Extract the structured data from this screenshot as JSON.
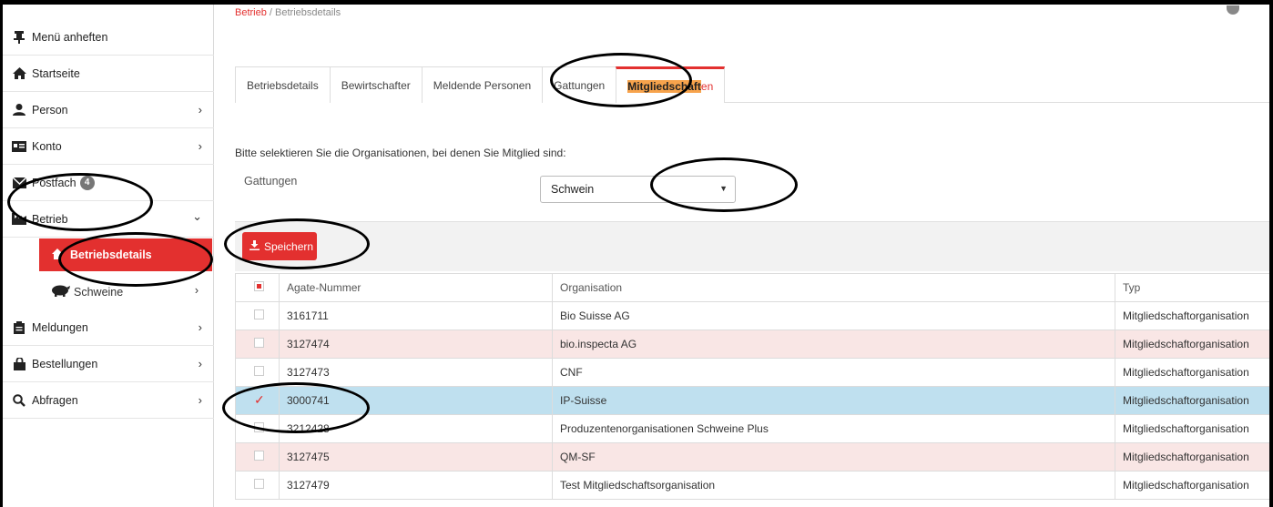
{
  "breadcrumb": {
    "first": "Betrieb",
    "sep": " / ",
    "second": "Betriebsdetails"
  },
  "sidebar": {
    "pin": {
      "label": "Menü anheften",
      "icon": "pin-icon"
    },
    "items": [
      {
        "label": "Startseite",
        "icon": "home-icon",
        "chevron": ""
      },
      {
        "label": "Person",
        "icon": "user-icon",
        "chevron": "›"
      },
      {
        "label": "Konto",
        "icon": "id-card-icon",
        "chevron": "›"
      },
      {
        "label": "Postfach",
        "icon": "envelope-icon",
        "chevron": "",
        "badge": "4"
      },
      {
        "label": "Betrieb",
        "icon": "factory-icon",
        "chevron": "⌄"
      },
      {
        "label": "Meldungen",
        "icon": "clipboard-icon",
        "chevron": "›"
      },
      {
        "label": "Bestellungen",
        "icon": "shopping-bag-icon",
        "chevron": "›"
      },
      {
        "label": "Abfragen",
        "icon": "search-icon",
        "chevron": "›"
      }
    ],
    "sub": [
      {
        "label": "Betriebsdetails",
        "icon": "home-icon",
        "active": true
      },
      {
        "label": "Schweine",
        "icon": "pig-icon",
        "chevron": "›"
      }
    ]
  },
  "tabs": [
    {
      "label": "Betriebsdetails"
    },
    {
      "label": "Bewirtschafter"
    },
    {
      "label": "Meldende Personen"
    },
    {
      "label": "Gattungen"
    },
    {
      "label_hl": "Mitgliedschaft",
      "label_rest": "en",
      "active": true
    }
  ],
  "hint": "Bitte selektieren Sie die Organisationen, bei denen Sie Mitglied sind:",
  "gattungen": {
    "label": "Gattungen",
    "selected": "Schwein"
  },
  "save_button": "Speichern",
  "table": {
    "headers": [
      "Agate-Nummer",
      "Organisation",
      "Typ"
    ],
    "rows": [
      {
        "agate": "3161711",
        "org": "Bio Suisse AG",
        "typ": "Mitgliedschaftorganisation",
        "checked": false
      },
      {
        "agate": "3127474",
        "org": "bio.inspecta AG",
        "typ": "Mitgliedschaftorganisation",
        "checked": false
      },
      {
        "agate": "3127473",
        "org": "CNF",
        "typ": "Mitgliedschaftorganisation",
        "checked": false
      },
      {
        "agate": "3000741",
        "org": "IP-Suisse",
        "typ": "Mitgliedschaftorganisation",
        "checked": true
      },
      {
        "agate": "3212428",
        "org": "Produzentenorganisationen Schweine Plus",
        "typ": "Mitgliedschaftorganisation",
        "checked": false
      },
      {
        "agate": "3127475",
        "org": "QM-SF",
        "typ": "Mitgliedschaftorganisation",
        "checked": false
      },
      {
        "agate": "3127479",
        "org": "Test Mitgliedschaftsorganisation",
        "typ": "Mitgliedschaftorganisation",
        "checked": false
      }
    ]
  },
  "colors": {
    "accent": "#e3302f",
    "highlight": "#f7a34c",
    "selected_row": "#bfe0ef",
    "shaded_row": "#f9e6e5"
  }
}
